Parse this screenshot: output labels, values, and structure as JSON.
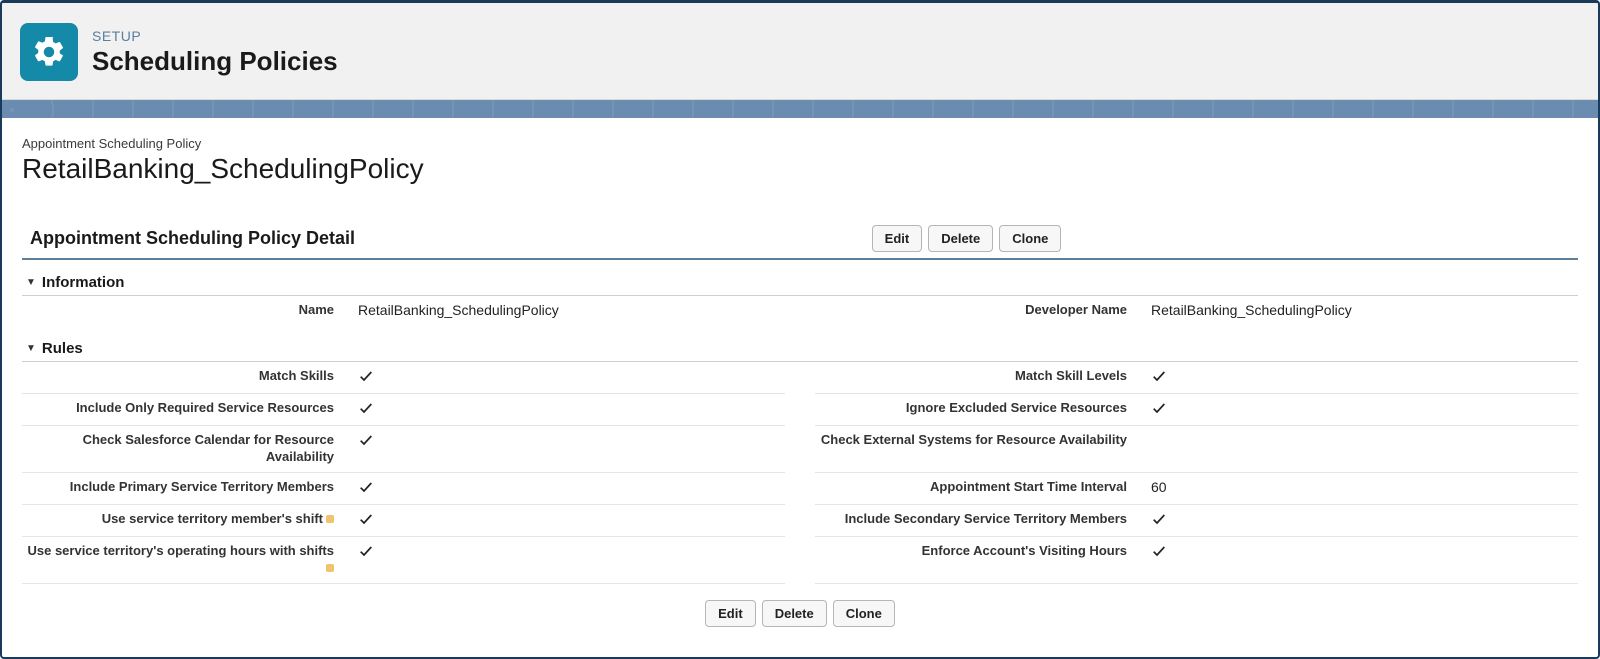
{
  "header": {
    "eyebrow": "SETUP",
    "title": "Scheduling Policies"
  },
  "record": {
    "type_label": "Appointment Scheduling Policy",
    "name": "RetailBanking_SchedulingPolicy",
    "detail_title": "Appointment Scheduling Policy Detail"
  },
  "buttons": {
    "edit": "Edit",
    "delete": "Delete",
    "clone": "Clone"
  },
  "sections": {
    "information": "Information",
    "rules": "Rules"
  },
  "info": {
    "name_label": "Name",
    "name_value": "RetailBanking_SchedulingPolicy",
    "dev_name_label": "Developer Name",
    "dev_name_value": "RetailBanking_SchedulingPolicy"
  },
  "rules": {
    "left": [
      {
        "label": "Match Skills",
        "checked": true,
        "help": false
      },
      {
        "label": "Include Only Required Service Resources",
        "checked": true,
        "help": false
      },
      {
        "label": "Check Salesforce Calendar for Resource Availability",
        "checked": true,
        "help": false
      },
      {
        "label": "Include Primary Service Territory Members",
        "checked": true,
        "help": false
      },
      {
        "label": "Use service territory member's shift",
        "checked": true,
        "help": true
      },
      {
        "label": "Use service territory's operating hours with shifts",
        "checked": true,
        "help": true
      }
    ],
    "right": [
      {
        "label": "Match Skill Levels",
        "checked": true,
        "help": false
      },
      {
        "label": "Ignore Excluded Service Resources",
        "checked": true,
        "help": false
      },
      {
        "label": "Check External Systems for Resource Availability",
        "checked": false,
        "help": false
      },
      {
        "label": "Appointment Start Time Interval",
        "value": "60",
        "help": false
      },
      {
        "label": "Include Secondary Service Territory Members",
        "checked": true,
        "help": false
      },
      {
        "label": "Enforce Account's Visiting Hours",
        "checked": true,
        "help": false
      }
    ]
  }
}
